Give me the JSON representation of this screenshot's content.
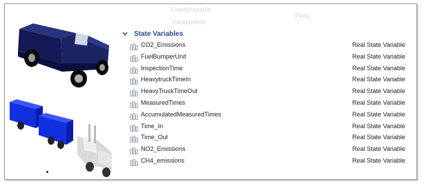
{
  "faint_labels": [
    "Fixedphasable",
    "Pedio",
    "Visualpoints"
  ],
  "section": {
    "label": "State Variables",
    "expand_icon": "chevron-down-icon",
    "accent_color": "#2b4a8a"
  },
  "variables": [
    {
      "name": "CO2_Emissions",
      "type": "Real State Variable"
    },
    {
      "name": "FuelBurnperUnit",
      "type": "Real State Variable"
    },
    {
      "name": "InspectionTime",
      "type": "Real State Variable"
    },
    {
      "name": "HeavytruckTimeIn",
      "type": "Real State Variable"
    },
    {
      "name": "HeavyTruckTimeOut",
      "type": "Real State Variable"
    },
    {
      "name": "MeasuredTimes",
      "type": "Real State Variable"
    },
    {
      "name": "AccumulatedMeasuredTimes",
      "type": "Real State Variable"
    },
    {
      "name": "Time_In",
      "type": "Real State Variable"
    },
    {
      "name": "Time_Out",
      "type": "Real State Variable"
    },
    {
      "name": "NO2_Emissions",
      "type": "Real State Variable"
    },
    {
      "name": "CH4_emissions",
      "type": "Real State Variable"
    }
  ],
  "images": {
    "pickup_color": "#1d2466",
    "trailer_color": "#1230e0",
    "cab_color": "#d9d9d9"
  }
}
